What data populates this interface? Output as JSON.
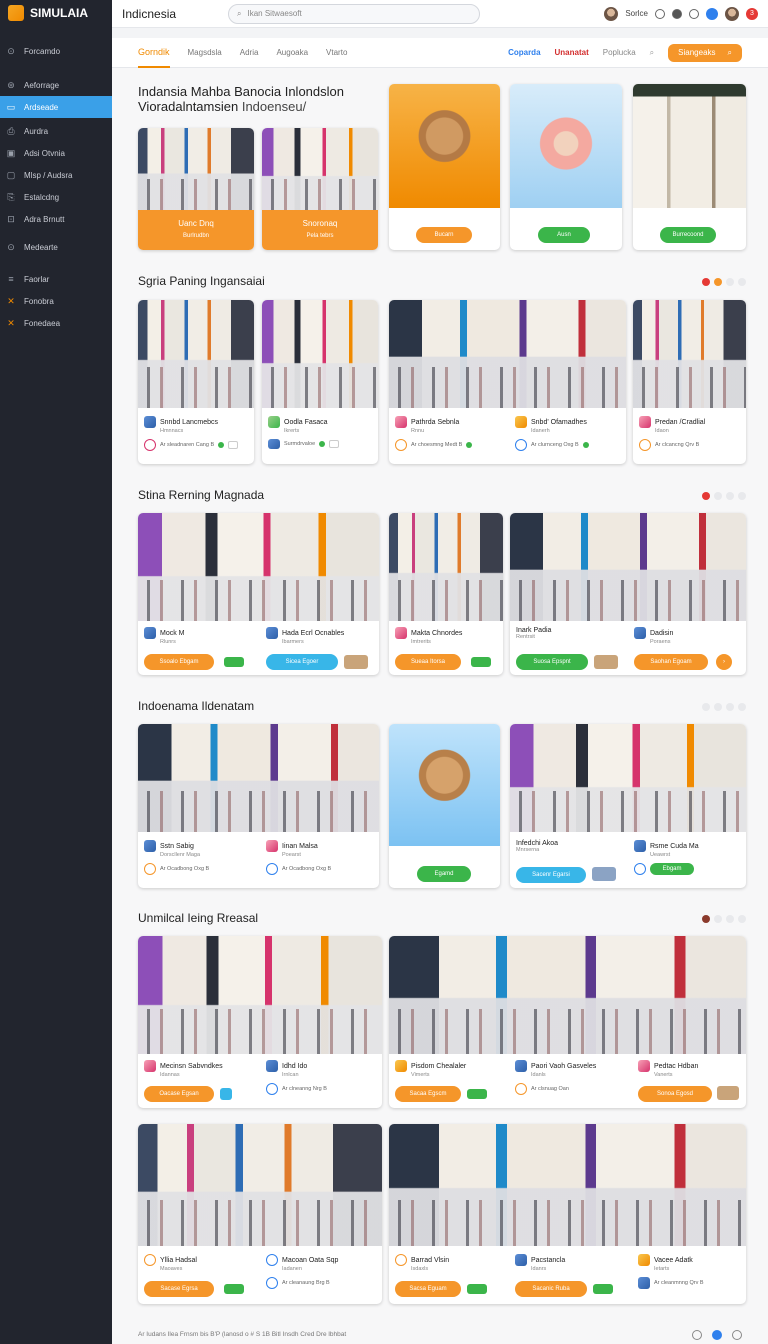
{
  "app": {
    "brand": "SIMULAIA",
    "title": "Indicnesia"
  },
  "search": {
    "placeholder": "Ikan Sitwaesoft"
  },
  "topbar": {
    "user_label": "Sorlce",
    "notif_count": "3"
  },
  "sidebar": {
    "items": [
      {
        "label": "Forcamdo",
        "icon": "home-icon"
      },
      {
        "label": "Aeforrage",
        "icon": "tag-icon"
      },
      {
        "label": "Ardseade",
        "icon": "grid-icon",
        "active": true
      },
      {
        "label": "Aurdra",
        "icon": "doc-icon"
      },
      {
        "label": "Adsi Otvnia",
        "icon": "calendar-icon"
      },
      {
        "label": "Mlsp / Audsra",
        "icon": "folder-icon"
      },
      {
        "label": "Estalcdng",
        "icon": "settings-icon"
      },
      {
        "label": "Adra Brnutt",
        "icon": "chart-icon"
      },
      {
        "label": "Medearte",
        "icon": "user-icon"
      },
      {
        "label": "Faorlar",
        "icon": "list-icon"
      },
      {
        "label": "Fonobra",
        "icon": "x-icon"
      },
      {
        "label": "Fonedaea",
        "icon": "x-icon"
      }
    ]
  },
  "tabs": [
    {
      "label": "Gorndik",
      "active": true
    },
    {
      "label": "Magsdsla"
    },
    {
      "label": "Adria"
    },
    {
      "label": "Augoaka"
    },
    {
      "label": "Vtarto"
    }
  ],
  "tab_right": {
    "blue": "Coparda",
    "red": "Unanatat",
    "grey": "Poplucka",
    "button": "Siangeaks"
  },
  "hero": {
    "title": "Indansia Mahba Banocia Inlondslon",
    "subtitle_a": "Vioradalntamsien",
    "subtitle_b": "Indoenseu/",
    "left_cards": [
      {
        "line1": "Uanc Dnq",
        "line2": "Burlrudbn"
      },
      {
        "line1": "Snoronaq",
        "line2": "Pela tebrs"
      }
    ],
    "promo_buttons": [
      "Bucarn",
      "Ausn",
      "Burrecoond"
    ]
  },
  "sections": [
    {
      "title": "Sgria Paning Ingansaiai",
      "cards": [
        {
          "name": "Snnbd Lancmebcs",
          "sub": "Hmnnacs",
          "meta": "Ar sleadnaren Cang B"
        },
        {
          "name": "Oodla Fasaca",
          "sub": "Ikrerts",
          "meta": "Surmdrvaloe"
        },
        {
          "name": "Pathrda Sebnla",
          "sub": "Rnnu",
          "meta": "Ar choesmng Medt B"
        },
        {
          "name": "Snbd' Ofamadhes",
          "sub": "Idanerh",
          "meta": "Ar clurnceng Oxg B"
        },
        {
          "name": "Predan /Cradlial",
          "sub": "Idaon",
          "meta": "Ar clcancng Qrv B"
        }
      ]
    },
    {
      "title": "Stina Rerning Magnada",
      "cards": [
        {
          "name": "Mock M",
          "sub": "Rlunrs",
          "btn": "Ssoalo Ebgam"
        },
        {
          "name": "Hada Ecrl Ocnables",
          "sub": "Ibarmers",
          "btn": "Sicea Egoer"
        },
        {
          "name": "Makta Chnordes",
          "sub": "Imtrerits",
          "btn": "Sueaa Itorsa"
        },
        {
          "name": "Inark Padia",
          "sub": "Rentrsit",
          "btn": "Suosa Epspnt"
        },
        {
          "name": "Dadisin",
          "sub": "Poraens",
          "btn": "Saohan Egoam"
        }
      ]
    },
    {
      "title": "Indoenama Ildenatam",
      "cards": [
        {
          "name": "Sstn Sabig",
          "sub": "Dorscllenr Maga",
          "meta": "Ar Ocadbong Oxg B"
        },
        {
          "name": "Iinan Malsa",
          "sub": "Poearst",
          "meta": "Ar Ocadbong Oxg B"
        },
        {
          "name": "",
          "sub": "",
          "btn": "Egamd"
        },
        {
          "name": "Infedchi Akoa",
          "sub": "Mnrserna",
          "btn": "Sacenr Egarsi"
        },
        {
          "name": "Rsme Cuda Ma",
          "sub": "Ueawrst",
          "meta": "Ar Ocaniang Bng B"
        }
      ]
    },
    {
      "title": "Unmilcal Ieing Rreasal",
      "cards": [
        {
          "name": "Mecinsn Sabvndkes",
          "sub": "Idannas",
          "btn": "Oacase Egsan"
        },
        {
          "name": "Idhd Ido",
          "sub": "Irnlcan",
          "meta": "Ar clneanng Nrg B"
        },
        {
          "name": "Pisdom Chealaler",
          "sub": "Vimerts",
          "btn": "Sacaa Egscm"
        },
        {
          "name": "Paori Vaoh Gasveles",
          "sub": "Idanls",
          "meta": "Ar clsnuag Oan"
        },
        {
          "name": "Pedtac Hdban",
          "sub": "Vanerts",
          "btn": "Sonoa Egosd"
        }
      ]
    },
    {
      "title": "",
      "cards": [
        {
          "name": "Yllia Hadsal",
          "sub": "Maoaves",
          "btn": "Sacase Egrsa"
        },
        {
          "name": "Macoan Oata Sqp",
          "sub": "Iadanen",
          "meta": "Ar cleanaung Brg B"
        },
        {
          "name": "Barrad Vlsin",
          "sub": "Isdaxls",
          "btn": "Sacsa Eguam"
        },
        {
          "name": "Pacstancla",
          "sub": "Idanrs",
          "btn": "Sacanic Ruba"
        },
        {
          "name": "Vacee Adatk",
          "sub": "Ietarts",
          "meta": "Ar cleanmnng Qrv B"
        }
      ]
    }
  ],
  "footer": {
    "text": "Ar Iudans Ilea Frnsm bis B'P (lanosd o # S 1B Bitl Insdh Cred Dre lbhbat"
  },
  "colors": {
    "accent": "#f5962a",
    "active": "#3aa0e8",
    "sidebar": "#22252e"
  }
}
